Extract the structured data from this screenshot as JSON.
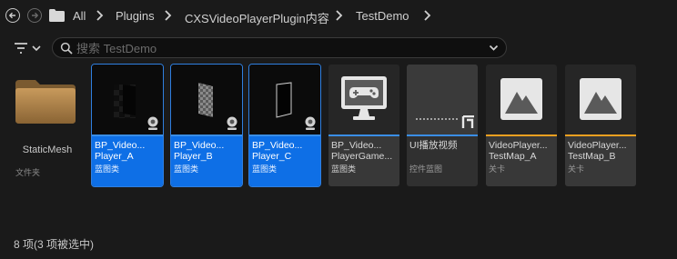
{
  "breadcrumb": {
    "items": [
      "All",
      "Plugins",
      "CXSVideoPlayerPlugin内容",
      "TestDemo"
    ]
  },
  "search": {
    "placeholder": "搜索 TestDemo"
  },
  "assets": [
    {
      "name1": "StaticMesh",
      "type": "文件夹",
      "icon": "folder-icon"
    },
    {
      "name1": "BP_Video...",
      "name2": "Player_A",
      "type": "蓝图类",
      "selected": true,
      "icon": "video-thumbnail"
    },
    {
      "name1": "BP_Video...",
      "name2": "Player_B",
      "type": "蓝图类",
      "selected": true,
      "icon": "video-thumbnail"
    },
    {
      "name1": "BP_Video...",
      "name2": "Player_C",
      "type": "蓝图类",
      "selected": true,
      "icon": "video-thumbnail"
    },
    {
      "name1": "BP_Video...",
      "name2": "PlayerGame...",
      "type": "蓝图类",
      "selected": false,
      "icon": "gamepad-monitor-icon"
    },
    {
      "name1": "UI播放视频",
      "type": "控件蓝图",
      "selected": false,
      "icon": "widget-thumbnail"
    },
    {
      "name1": "VideoPlayer...",
      "name2": "TestMap_A",
      "type": "关卡",
      "selected": false,
      "icon": "level-icon"
    },
    {
      "name1": "VideoPlayer...",
      "name2": "TestMap_B",
      "type": "关卡",
      "selected": false,
      "icon": "level-icon"
    }
  ],
  "status": "8 项(3 项被选中)",
  "colors": {
    "selected": "#0e6fe6",
    "blueprint_bar": "#3a8ee6",
    "level_bar": "#f0a020",
    "widget_bar": "#3a8ee6"
  }
}
